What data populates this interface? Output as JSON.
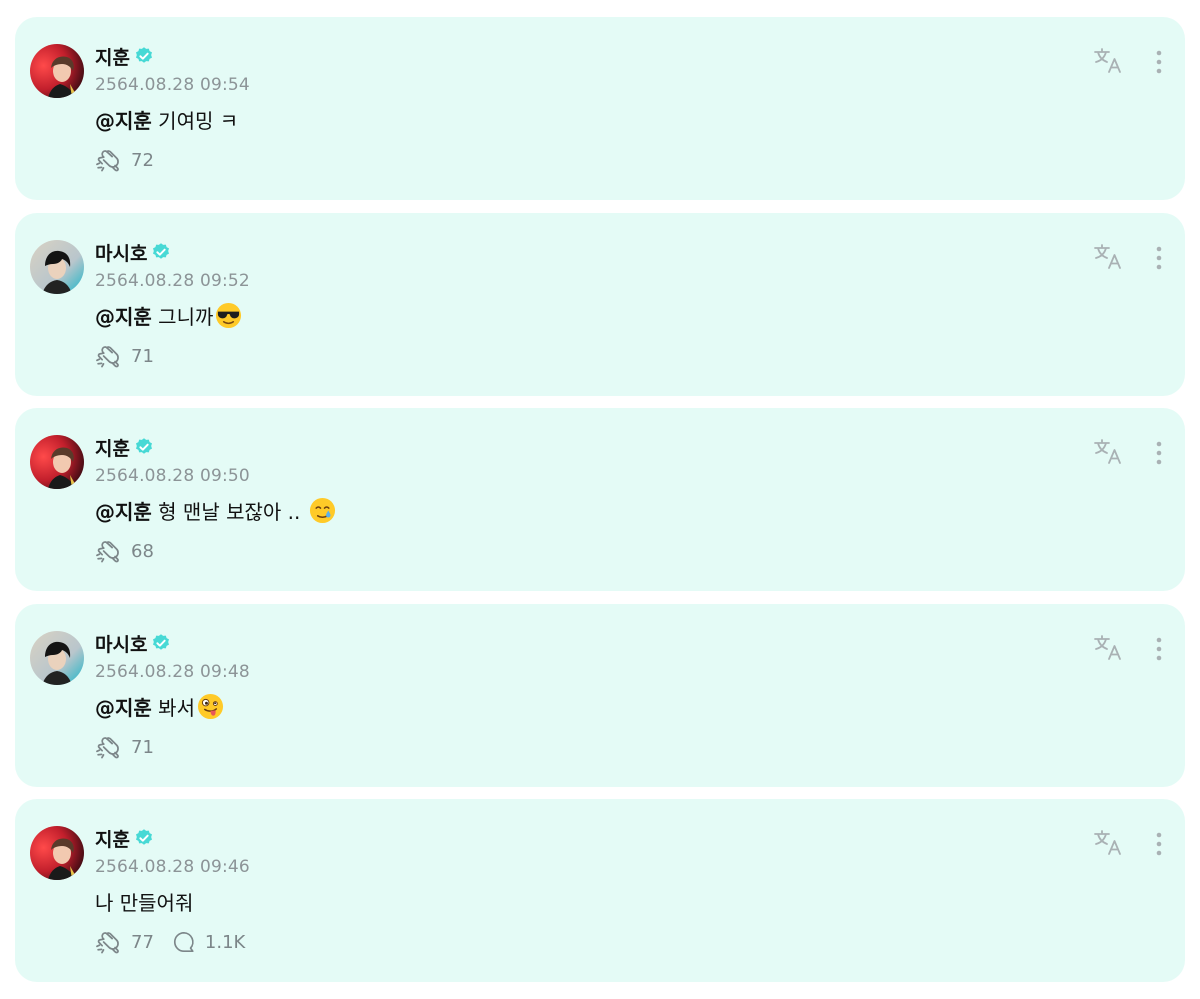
{
  "colors": {
    "card_bg": "#e4fbf6",
    "verified": "#47d9d5",
    "muted": "#8c9497"
  },
  "icons": {
    "verified": "verified-badge-icon",
    "like": "like-hand-icon",
    "comment": "comment-bubble-icon",
    "translate": "translate-icon",
    "more": "more-vertical-icon"
  },
  "comments": [
    {
      "author": "지훈",
      "avatar": "jihoon",
      "time": "2564.08.28 09:54",
      "mention": "@지훈",
      "text": " 기여밍 ㅋ",
      "emoji": "",
      "likes": "72",
      "replies": ""
    },
    {
      "author": "마시호",
      "avatar": "mashiho",
      "time": "2564.08.28 09:52",
      "mention": "@지훈",
      "text": " 그니까",
      "emoji": "sunglasses",
      "likes": "71",
      "replies": ""
    },
    {
      "author": "지훈",
      "avatar": "jihoon",
      "time": "2564.08.28 09:50",
      "mention": "@지훈",
      "text": " 형 맨날 보잖아 .. ",
      "emoji": "tear-smile",
      "likes": "68",
      "replies": ""
    },
    {
      "author": "마시호",
      "avatar": "mashiho",
      "time": "2564.08.28 09:48",
      "mention": "@지훈",
      "text": " 봐서",
      "emoji": "zany",
      "likes": "71",
      "replies": ""
    },
    {
      "author": "지훈",
      "avatar": "jihoon",
      "time": "2564.08.28 09:46",
      "mention": "",
      "text": "나 만들어줘",
      "emoji": "",
      "likes": "77",
      "replies": "1.1K"
    }
  ]
}
